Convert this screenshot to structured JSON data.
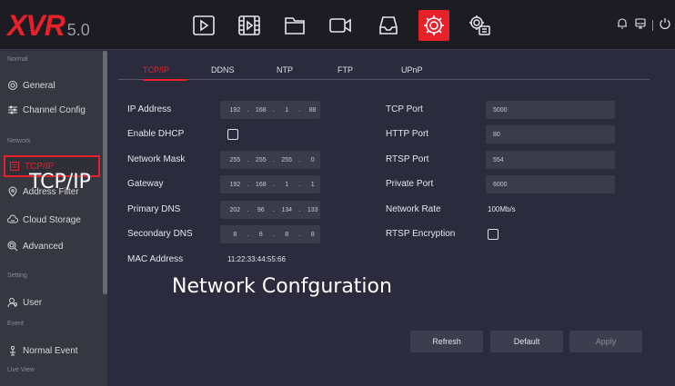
{
  "app": {
    "brand": "XVR",
    "version": "5.0"
  },
  "topbar": {
    "icons": [
      "playback-icon",
      "video-clip-icon",
      "folder-icon",
      "camera-icon",
      "storage-icon",
      "settings-gear-icon",
      "system-config-icon"
    ],
    "active_icon": "settings-gear-icon",
    "tray": [
      "bell-icon",
      "network-icon",
      "power-icon"
    ]
  },
  "sidebar": {
    "sections": {
      "normal": "Normal",
      "network": "Network",
      "setting": "Setting",
      "event": "Event",
      "live_view": "Live View"
    },
    "items": {
      "general": "General",
      "channel_config": "Channel Config",
      "tcpip": "TCP/IP",
      "address_filter": "Address Filter",
      "cloud_storage": "Cloud Storage",
      "advanced": "Advanced",
      "user": "User",
      "normal_event": "Normal Event"
    }
  },
  "tabs": {
    "tcpip": "TCP/IP",
    "ddns": "DDNS",
    "ntp": "NTP",
    "ftp": "FTP",
    "upnp": "UPnP"
  },
  "form": {
    "left": {
      "ip_address": {
        "label": "IP Address",
        "octets": [
          "192",
          "168",
          "1",
          "88"
        ]
      },
      "enable_dhcp": {
        "label": "Enable DHCP",
        "checked": false
      },
      "network_mask": {
        "label": "Network Mask",
        "octets": [
          "255",
          "255",
          "255",
          "0"
        ]
      },
      "gateway": {
        "label": "Gateway",
        "octets": [
          "192",
          "168",
          "1",
          "1"
        ]
      },
      "primary_dns": {
        "label": "Primary DNS",
        "octets": [
          "202",
          "96",
          "134",
          "133"
        ]
      },
      "secondary_dns": {
        "label": "Secondary DNS",
        "octets": [
          "8",
          "8",
          "8",
          "8"
        ]
      },
      "mac_address": {
        "label": "MAC Address",
        "value": "11:22:33:44:55:66"
      }
    },
    "right": {
      "tcp_port": {
        "label": "TCP Port",
        "value": "5000"
      },
      "http_port": {
        "label": "HTTP Port",
        "value": "80"
      },
      "rtsp_port": {
        "label": "RTSP Port",
        "value": "554"
      },
      "private_port": {
        "label": "Private Port",
        "value": "6000"
      },
      "network_rate": {
        "label": "Network Rate",
        "value": "100Mb/s"
      },
      "rtsp_encryption": {
        "label": "RTSP Encryption",
        "checked": false
      }
    }
  },
  "buttons": {
    "refresh": "Refresh",
    "default": "Default",
    "apply": "Apply"
  },
  "overlays": {
    "tcpip": "TCP/IP",
    "network": "Network Confguration"
  },
  "colors": {
    "accent": "#e8202a",
    "background": "#2b2b3d",
    "sidebar": "#373741",
    "topbar": "#1c1c22"
  }
}
